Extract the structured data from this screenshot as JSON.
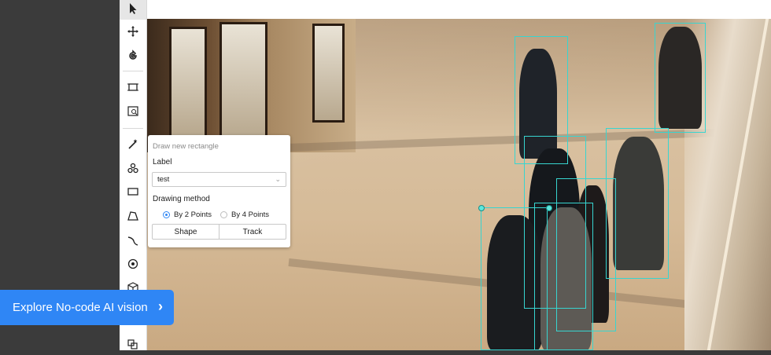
{
  "toolbar": {
    "tools": [
      {
        "name": "select",
        "icon": "cursor-arrow-icon",
        "active": true
      },
      {
        "name": "move",
        "icon": "move-arrows-icon"
      },
      {
        "name": "rotate",
        "icon": "rotate-icon"
      },
      {
        "name": "fit",
        "icon": "fit-frame-icon"
      },
      {
        "name": "zoom-region",
        "icon": "zoom-region-icon"
      },
      {
        "name": "magic",
        "icon": "magic-wand-icon"
      },
      {
        "name": "ai-tools",
        "icon": "ai-cluster-icon"
      },
      {
        "name": "rectangle",
        "icon": "rectangle-icon"
      },
      {
        "name": "polygon",
        "icon": "polygon-icon"
      },
      {
        "name": "polyline",
        "icon": "polyline-icon"
      },
      {
        "name": "point",
        "icon": "point-icon"
      },
      {
        "name": "cuboid",
        "icon": "cuboid-icon"
      },
      {
        "name": "group",
        "icon": "group-icon"
      }
    ]
  },
  "popup": {
    "title": "Draw new rectangle",
    "label_heading": "Label",
    "label_value": "test",
    "method_heading": "Drawing method",
    "options": [
      "By 2 Points",
      "By 4 Points"
    ],
    "selected_option": "By 2 Points",
    "buttons": [
      "Shape",
      "Track"
    ]
  },
  "cta": {
    "label": "Explore No-code AI vision",
    "arrow": "›"
  },
  "colors": {
    "accent": "#2f86f5",
    "bbox": "#37d5d0",
    "sidebar_dark": "#3b3b3b"
  }
}
